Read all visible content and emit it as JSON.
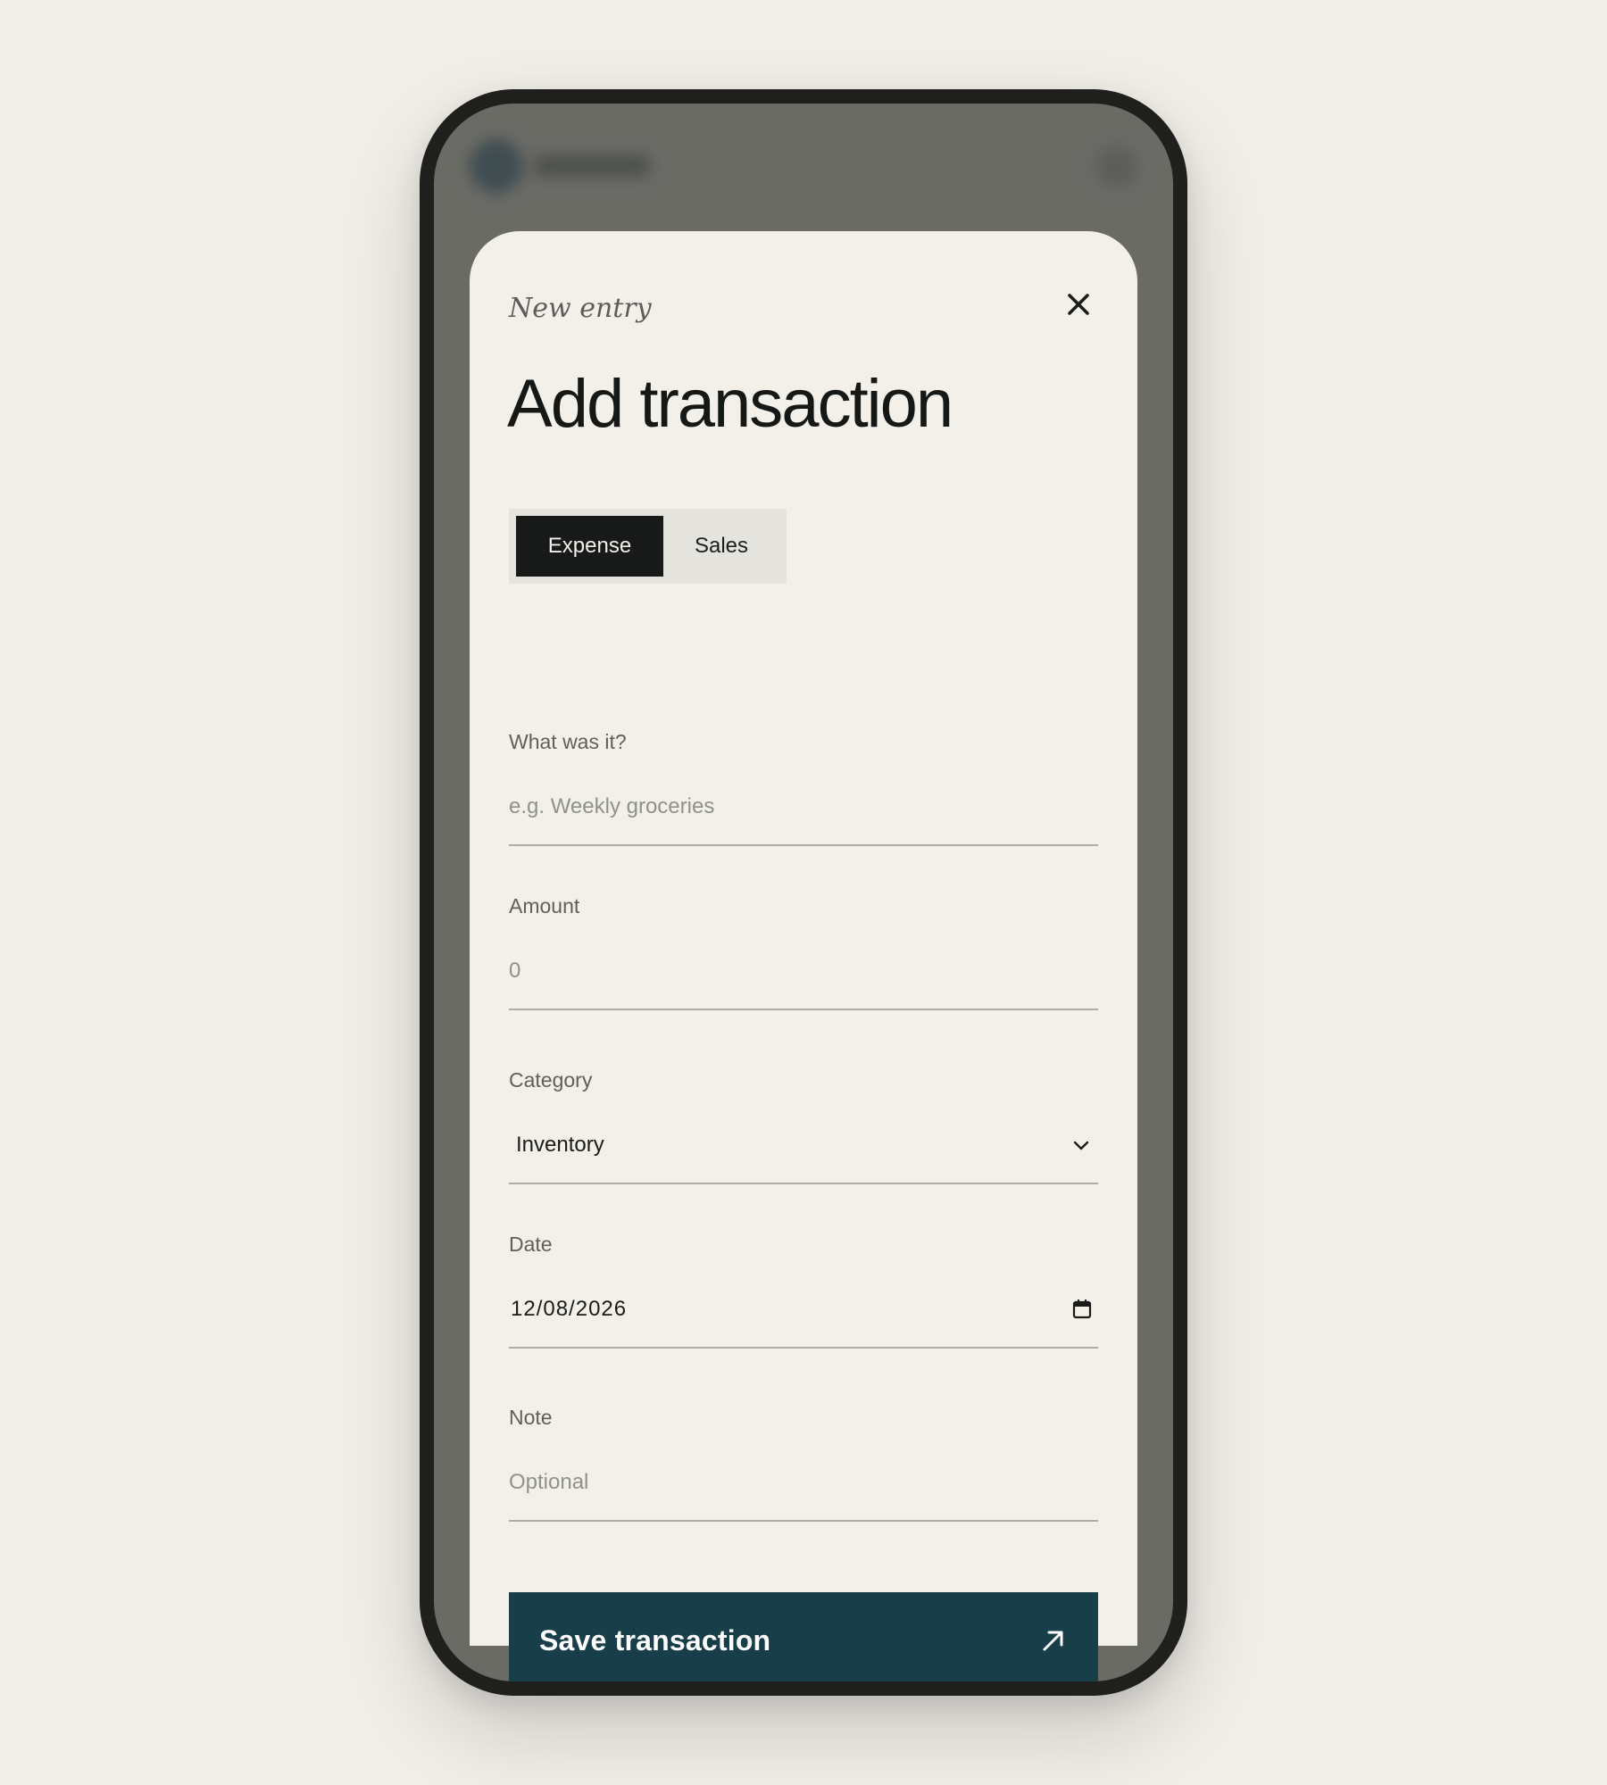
{
  "modal": {
    "eyebrow": "New entry",
    "title": "Add transaction",
    "close_icon": "close-icon"
  },
  "type_toggle": {
    "options": [
      {
        "label": "Expense",
        "selected": true
      },
      {
        "label": "Sales",
        "selected": false
      }
    ]
  },
  "fields": {
    "description": {
      "label": "What was it?",
      "value": "",
      "placeholder": "e.g. Weekly groceries"
    },
    "amount": {
      "label": "Amount",
      "value": "",
      "placeholder": "0"
    },
    "category": {
      "label": "Category",
      "value": "Inventory",
      "icon": "chevron-down-icon"
    },
    "date": {
      "label": "Date",
      "value": "12/08/2026",
      "icon": "calendar-icon"
    },
    "note": {
      "label": "Note",
      "value": "",
      "placeholder": "Optional"
    }
  },
  "actions": {
    "save_label": "Save transaction",
    "save_icon": "arrow-up-right-icon"
  },
  "colors": {
    "page_background": "#f1eee8",
    "sheet_background": "#f3f0ea",
    "primary_button": "#183e4a",
    "segment_active": "#171a19",
    "segment_track": "#e4e3dd",
    "text_primary": "#161816",
    "text_muted": "#5f605c"
  }
}
